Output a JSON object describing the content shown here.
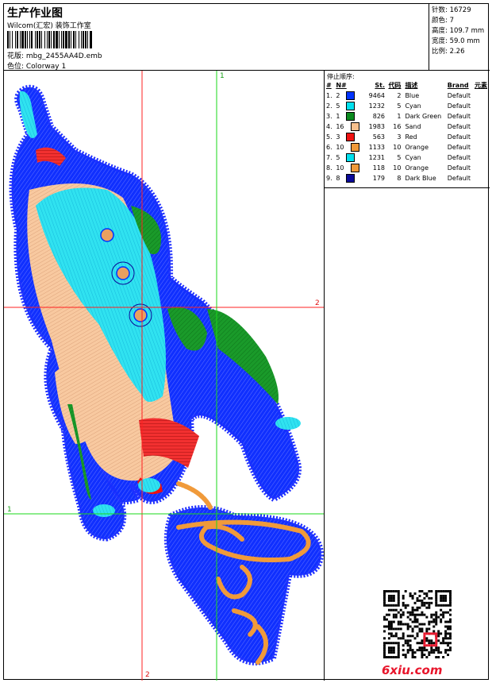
{
  "header": {
    "title": "生产作业图",
    "company": "Wilcom(汇宏) 装饰工作室",
    "design_label": "花版: mbg_2455AA4D.emb",
    "colorway_label": "色位: Colorway 1"
  },
  "info": {
    "stitches": "针数: 16729",
    "colors": "颜色: 7",
    "height": "高度: 109.7 mm",
    "width": "宽度: 59.0 mm",
    "scale": "比例: 2.26"
  },
  "sequence": {
    "caption": "停止顺序:",
    "headers": [
      "#",
      "N#",
      "St.",
      "代码",
      "描述",
      "Brand",
      "元素"
    ],
    "rows": [
      {
        "idx": "1.",
        "n": "2",
        "st": "9464",
        "code": "2",
        "desc": "Blue",
        "brand": "Default",
        "color": "#0033ff"
      },
      {
        "idx": "2.",
        "n": "5",
        "st": "1232",
        "code": "5",
        "desc": "Cyan",
        "brand": "Default",
        "color": "#00e0ee"
      },
      {
        "idx": "3.",
        "n": "1",
        "st": "826",
        "code": "1",
        "desc": "Dark Green",
        "brand": "Default",
        "color": "#0a8a1e"
      },
      {
        "idx": "4.",
        "n": "16",
        "st": "1983",
        "code": "16",
        "desc": "Sand",
        "brand": "Default",
        "color": "#f7c08e"
      },
      {
        "idx": "5.",
        "n": "3",
        "st": "563",
        "code": "3",
        "desc": "Red",
        "brand": "Default",
        "color": "#ee1111"
      },
      {
        "idx": "6.",
        "n": "10",
        "st": "1133",
        "code": "10",
        "desc": "Orange",
        "brand": "Default",
        "color": "#f09a3a"
      },
      {
        "idx": "7.",
        "n": "5",
        "st": "1231",
        "code": "5",
        "desc": "Cyan",
        "brand": "Default",
        "color": "#00e0ee"
      },
      {
        "idx": "8.",
        "n": "10",
        "st": "118",
        "code": "10",
        "desc": "Orange",
        "brand": "Default",
        "color": "#f09a3a"
      },
      {
        "idx": "9.",
        "n": "8",
        "st": "179",
        "code": "8",
        "desc": "Dark Blue",
        "brand": "Default",
        "color": "#0a0a99"
      }
    ]
  },
  "guides": {
    "top": "1",
    "right": "2",
    "left": "1",
    "bottom": "2"
  },
  "watermark": {
    "logo": "6xiu.com"
  }
}
